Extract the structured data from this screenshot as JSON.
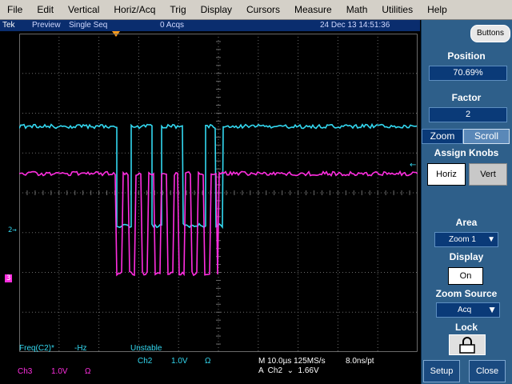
{
  "menu": [
    "File",
    "Edit",
    "Vertical",
    "Horiz/Acq",
    "Trig",
    "Display",
    "Cursors",
    "Measure",
    "Math",
    "Utilities",
    "Help"
  ],
  "status": {
    "brand": "Tek",
    "mode": "Preview",
    "acq_mode": "Single Seq",
    "acq_count": "0 Acqs",
    "datetime": "24 Dec 13 14:51:36"
  },
  "colors": {
    "ch2": "#33d8f0",
    "ch3": "#ff2ee0",
    "grid": "#6a6a6a",
    "trigger": "#ff9b1a"
  },
  "markers": {
    "ch2": "2",
    "ch3": "3"
  },
  "measurement": {
    "label": "Freq(C2)*",
    "value": "-Hz",
    "status": "Unstable"
  },
  "bottom": {
    "ch2_label": "Ch2",
    "ch2_scale": "1.0V",
    "ch2_coupling": "Ω",
    "ch3_label": "Ch3",
    "ch3_scale": "1.0V",
    "ch3_coupling": "Ω",
    "timebase": "M 10.0µs 125MS/s",
    "resolution": "8.0ns/pt",
    "trigger": "A  Ch2  ⌄  1.66V"
  },
  "panel": {
    "buttons_label": "Buttons",
    "position_label": "Position",
    "position_value": "70.69%",
    "factor_label": "Factor",
    "factor_value": "2",
    "zoom_tab": "Zoom",
    "scroll_tab": "Scroll",
    "assign_knobs_label": "Assign Knobs",
    "horiz_button": "Horiz",
    "vert_button": "Vert",
    "area_label": "Area",
    "area_value": "Zoom 1",
    "display_label": "Display",
    "display_value": "On",
    "zoom_source_label": "Zoom Source",
    "zoom_source_value": "Acq",
    "lock_label": "Lock",
    "setup_button": "Setup",
    "close_button": "Close"
  }
}
